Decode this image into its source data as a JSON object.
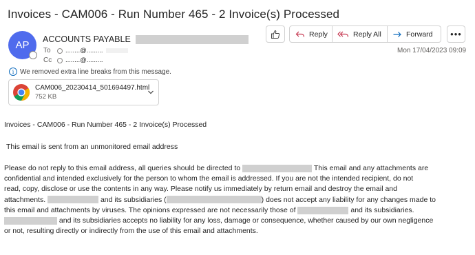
{
  "email": {
    "subject": "Invoices - CAM006 - Run Number 465 - 2 Invoice(s) Processed",
    "sender": {
      "initials": "AP",
      "name": "ACCOUNTS PAYABLE"
    },
    "to": {
      "label": "To",
      "value": "........@........."
    },
    "cc": {
      "label": "Cc",
      "value": "........@........."
    },
    "date": "Mon 17/04/2023 09:09",
    "notice": "We removed extra line breaks from this message.",
    "attachment": {
      "name": "CAM006_20230414_501694497.html",
      "size": "752 KB"
    }
  },
  "toolbar": {
    "reply_label": "Reply",
    "reply_all_label": "Reply All",
    "forward_label": "Forward",
    "more_label": "•••"
  },
  "body": {
    "line1": "Invoices - CAM006  - Run Number 465 - 2 Invoice(s) Processed",
    "line2": "This email is sent from an unmonitored email address",
    "p1a": "Please do not reply to this email address, all queries should be directed to ",
    "p1b": " This email and any attachments are",
    "p2": "confidential and intended exclusively for the person to whom the email is addressed. If you are not the intended recipient, do not",
    "p3": "read, copy, disclose or use the contents in any way. Please notify us immediately by return email and destroy the email and",
    "p4a": "attachments. ",
    "p4b": " and its subsidiaries (",
    "p4c": ") does not accept any liability for any changes made to",
    "p5a": "this email and attachments by viruses. The opinions expressed are not necessarily those of ",
    "p5b": " and its subsidiaries.",
    "p6b": " and its subsidiaries accepts no liability for any loss, damage or consequence, whether caused by our own negligence",
    "p7": "or not, resulting directly or indirectly from the use of this email and attachments."
  },
  "colors": {
    "avatar": "#4f6bed",
    "accent": "#0f6cbd",
    "redaction": "#d0d0d0"
  }
}
